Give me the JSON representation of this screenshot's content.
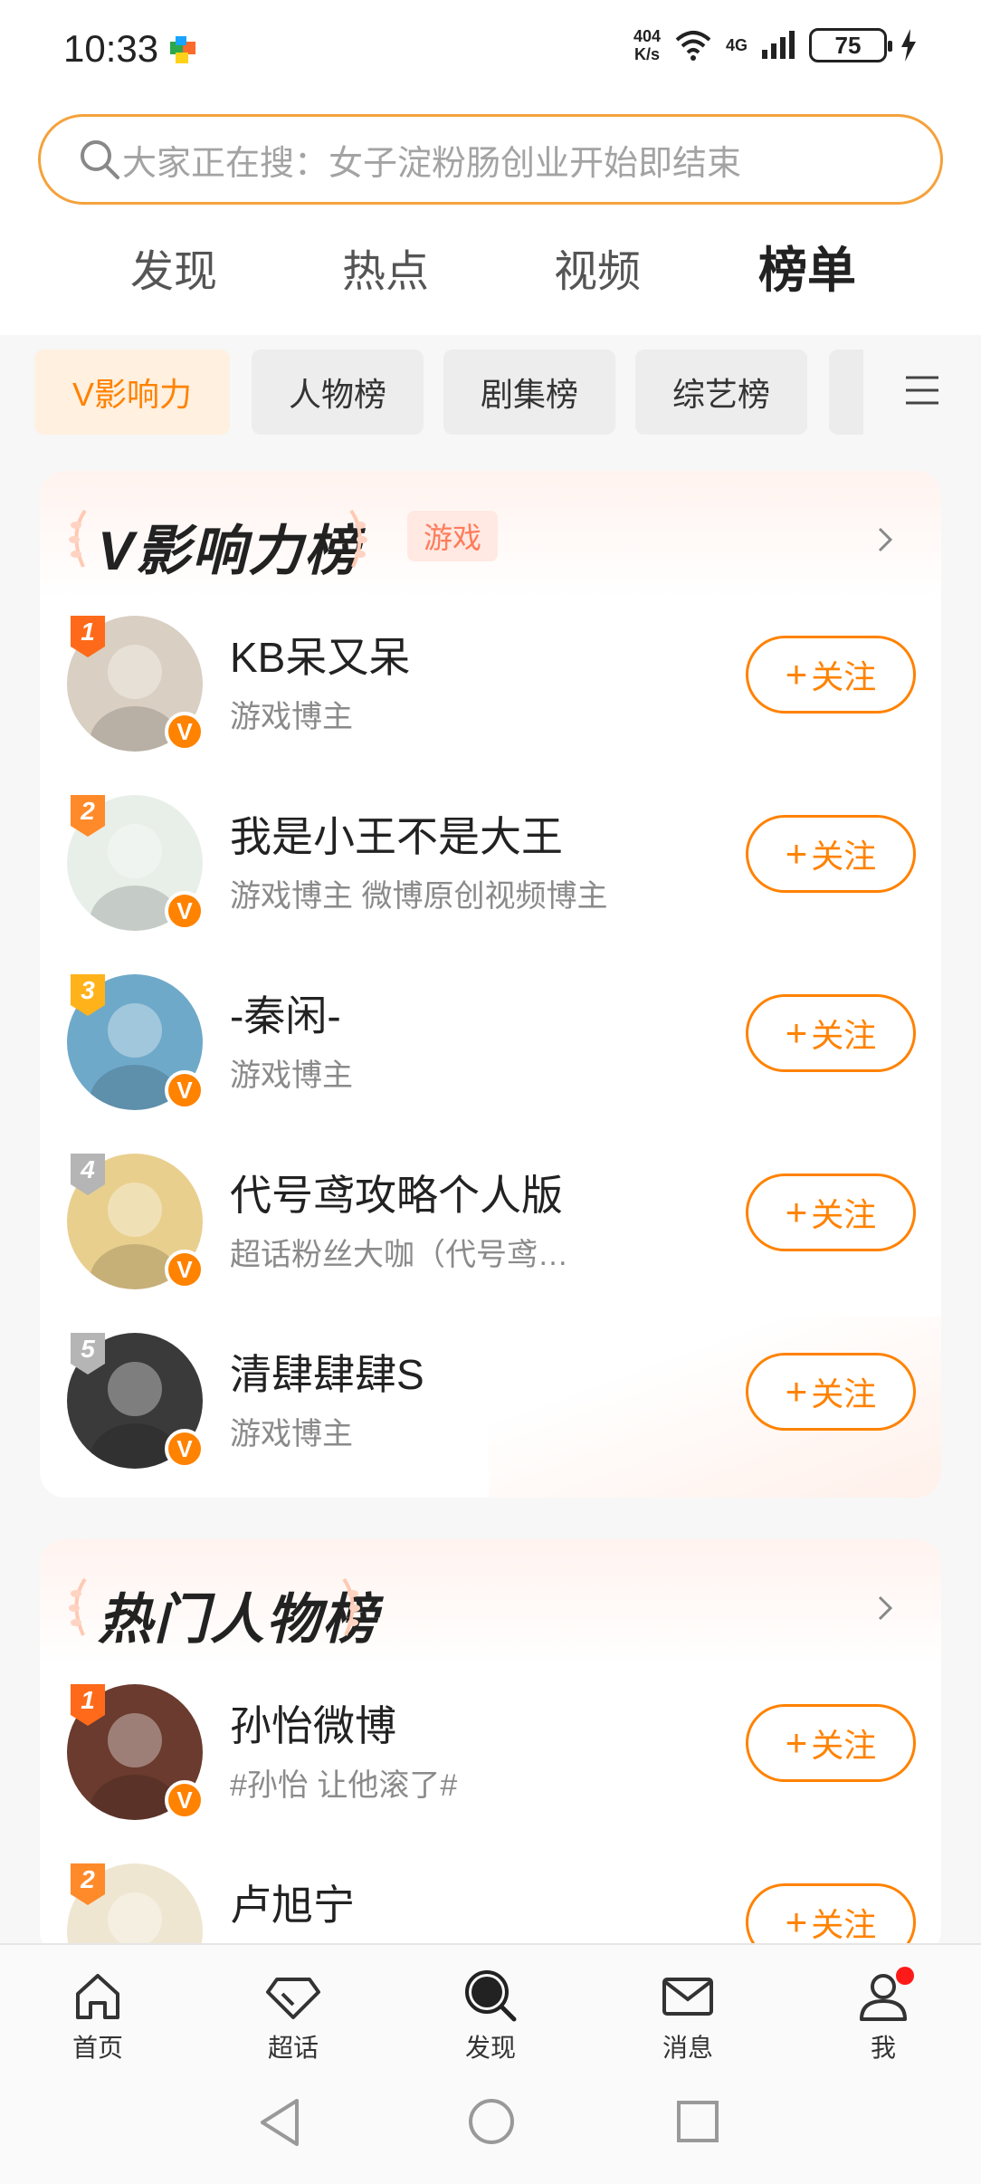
{
  "status_bar": {
    "time": "10:33",
    "net_speed_value": "404",
    "net_speed_unit": "K/s",
    "signal_label": "4G",
    "battery": "75"
  },
  "search": {
    "placeholder": "大家正在搜：女子淀粉肠创业开始即结束"
  },
  "tabs": [
    {
      "label": "发现"
    },
    {
      "label": "热点"
    },
    {
      "label": "视频"
    },
    {
      "label": "榜单",
      "active": true
    }
  ],
  "chips": [
    {
      "label": "V影响力",
      "active": true
    },
    {
      "label": "人物榜"
    },
    {
      "label": "剧集榜"
    },
    {
      "label": "综艺榜"
    }
  ],
  "influence_card": {
    "title": "V影响力榜",
    "category": "游戏",
    "items": [
      {
        "rank": "1",
        "name": "KB呆又呆",
        "desc": "游戏博主",
        "follow": "关注",
        "rank_color": "#ff6a1a",
        "avatar_color": "#d9cfc2"
      },
      {
        "rank": "2",
        "name": "我是小王不是大王",
        "desc": "游戏博主 微博原创视频博主",
        "follow": "关注",
        "rank_color": "#ff8a2a",
        "avatar_color": "#e8efe9"
      },
      {
        "rank": "3",
        "name": "-秦闲-",
        "desc": "游戏博主",
        "follow": "关注",
        "rank_color": "#ffb21a",
        "avatar_color": "#6fa9c9"
      },
      {
        "rank": "4",
        "name": "代号鸢攻略个人版",
        "desc": "超话粉丝大咖（代号鸢…",
        "follow": "关注",
        "rank_color": "#b5b5b5",
        "avatar_color": "#e9cf8e"
      },
      {
        "rank": "5",
        "name": "清肆肆肆S",
        "desc": "游戏博主",
        "follow": "关注",
        "rank_color": "#b5b5b5",
        "avatar_color": "#3a3a3a"
      }
    ]
  },
  "hot_people_card": {
    "title": "热门人物榜",
    "items": [
      {
        "rank": "1",
        "name": "孙怡微博",
        "desc": "#孙怡 让他滚了#",
        "follow": "关注",
        "rank_color": "#ff6a1a",
        "avatar_color": "#6a3b2e"
      },
      {
        "rank": "2",
        "name": "卢旭宁",
        "desc": "",
        "follow": "关注",
        "rank_color": "#ff8a2a",
        "avatar_color": "#efe6d2"
      }
    ]
  },
  "bottom_nav": [
    {
      "label": "首页",
      "icon": "home-icon"
    },
    {
      "label": "超话",
      "icon": "diamond-icon"
    },
    {
      "label": "发现",
      "icon": "discover-icon"
    },
    {
      "label": "消息",
      "icon": "mail-icon"
    },
    {
      "label": "我",
      "icon": "profile-icon"
    }
  ],
  "accent_color": "#ff8200"
}
